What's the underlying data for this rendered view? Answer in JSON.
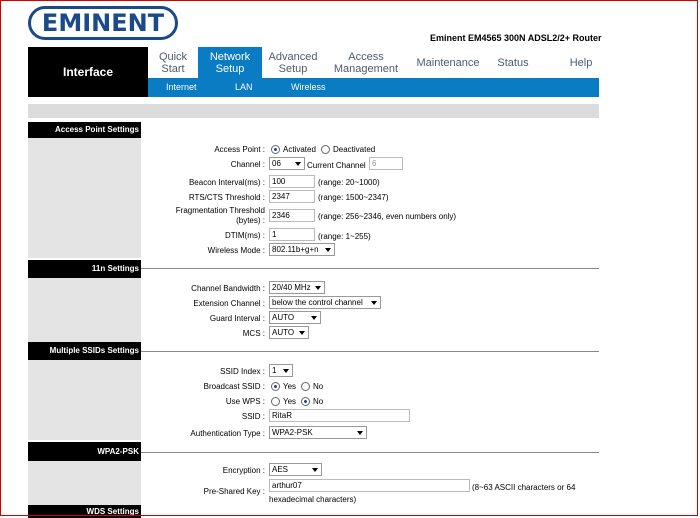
{
  "brand": {
    "logo": "EMINENT",
    "model": "Eminent EM4565 300N ADSL2/2+ Router"
  },
  "nav": {
    "interface": "Interface",
    "tabs": [
      {
        "line1": "Quick",
        "line2": "Start"
      },
      {
        "line1": "Network",
        "line2": "Setup"
      },
      {
        "line1": "Advanced",
        "line2": "Setup"
      },
      {
        "line1": "Access",
        "line2": "Management"
      },
      {
        "line1": "Maintenance",
        "line2": ""
      },
      {
        "line1": "Status",
        "line2": ""
      },
      {
        "line1": "Help",
        "line2": ""
      }
    ],
    "subtabs": [
      "Internet",
      "LAN",
      "Wireless"
    ]
  },
  "ap": {
    "section": "Access Point Settings",
    "access_point_label": "Access Point :",
    "activated": "Activated",
    "deactivated": "Deactivated",
    "channel_label": "Channel :",
    "channel_value": "06",
    "current_channel_label": "Current Channel",
    "current_channel_value": "6",
    "beacon_label": "Beacon Interval(ms) :",
    "beacon_value": "100",
    "beacon_range": "(range: 20~1000)",
    "rts_label": "RTS/CTS Threshold :",
    "rts_value": "2347",
    "rts_range": "(range: 1500~2347)",
    "frag_label_1": "Fragmentation Threshold",
    "frag_label_2": "(bytes) :",
    "frag_value": "2346",
    "frag_range": "(range: 256~2346, even numbers only)",
    "dtim_label": "DTIM(ms) :",
    "dtim_value": "1",
    "dtim_range": "(range: 1~255)",
    "mode_label": "Wireless Mode :",
    "mode_value": "802.11b+g+n"
  },
  "n11": {
    "section": "11n Settings",
    "bw_label": "Channel Bandwidth :",
    "bw_value": "20/40 MHz",
    "ext_label": "Extension Channel :",
    "ext_value": "below the control channel",
    "guard_label": "Guard Interval :",
    "guard_value": "AUTO",
    "mcs_label": "MCS :",
    "mcs_value": "AUTO"
  },
  "ssid": {
    "section": "Multiple SSIDs Settings",
    "index_label": "SSID Index :",
    "index_value": "1",
    "broadcast_label": "Broadcast SSID :",
    "yes": "Yes",
    "no": "No",
    "wps_label": "Use WPS :",
    "ssid_label": "SSID :",
    "ssid_value": "RitaR",
    "auth_label": "Authentication Type :",
    "auth_value": "WPA2-PSK"
  },
  "wpa": {
    "section": "WPA2-PSK",
    "enc_label": "Encryption :",
    "enc_value": "AES",
    "psk_label": "Pre-Shared Key :",
    "psk_value": "arthur07",
    "psk_hint_1": "(8~63 ASCII characters or 64",
    "psk_hint_2": "hexadecimal characters)"
  },
  "wds": {
    "section": "WDS Settings"
  }
}
